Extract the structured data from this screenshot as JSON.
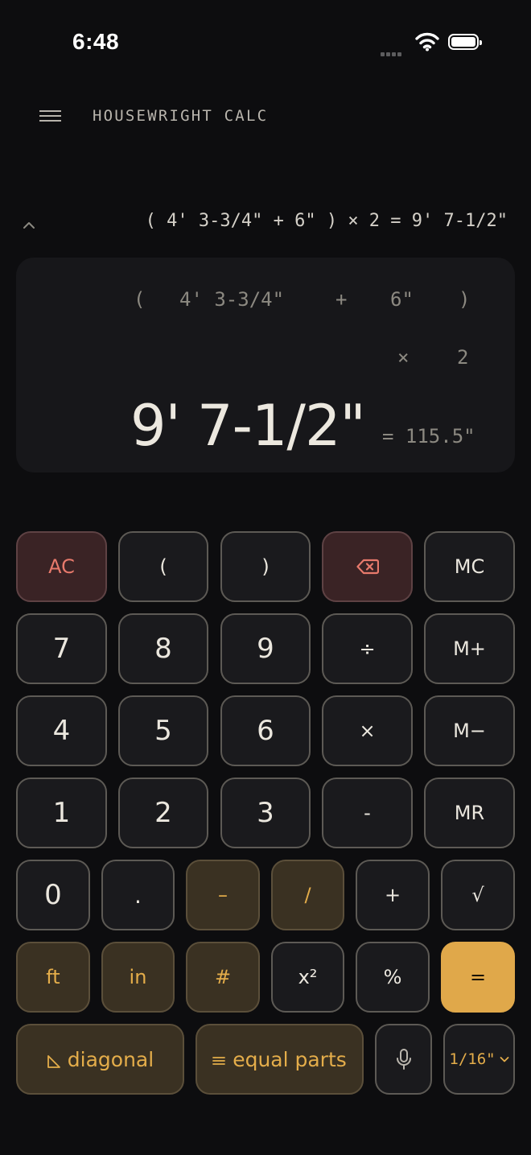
{
  "status": {
    "time": "6:48"
  },
  "header": {
    "menu_icon": "hamburger-menu-icon",
    "title": "HOUSEWRIGHT CALC"
  },
  "history": {
    "toggle_icon": "chevron-up-icon",
    "line": "( 4' 3-3/4\" + 6\" ) × 2 = 9' 7-1/2\""
  },
  "display": {
    "row1": [
      "(",
      "4' 3-3/4\"",
      "+",
      "6\"",
      ")"
    ],
    "row2": [
      "×",
      "2"
    ],
    "result": "9' 7-1/2\"",
    "result_decimal": "= 115.5\""
  },
  "keys": {
    "ac": "AC",
    "open_paren": "(",
    "close_paren": ")",
    "backspace_icon": "backspace-icon",
    "mc": "MC",
    "seven": "7",
    "eight": "8",
    "nine": "9",
    "divide": "÷",
    "m_plus": "M+",
    "four": "4",
    "five": "5",
    "six": "6",
    "multiply": "×",
    "m_minus": "M−",
    "one": "1",
    "two": "2",
    "three": "3",
    "subtract": "-",
    "mr": "MR",
    "zero": "0",
    "decimal": ".",
    "dash": "–",
    "slash": "/",
    "add": "+",
    "sqrt": "√",
    "feet": "ft",
    "inch": "in",
    "hash": "#",
    "square": "x²",
    "percent": "%",
    "equals": "=",
    "diagonal": "diagonal",
    "diagonal_icon": "triangle-ruler-icon",
    "equal_parts": "equal parts",
    "equal_parts_icon": "equal-lines-icon",
    "mic_icon": "microphone-icon",
    "precision": "1/16\"",
    "precision_icon": "chevron-down-icon"
  },
  "colors": {
    "background": "#0d0d0f",
    "display_bg": "#17171a",
    "key_bg": "#1a1a1d",
    "danger_bg": "#3a2325",
    "danger_text": "#e87a6c",
    "gold_bg": "#3a3122",
    "gold_text": "#e4ad4a",
    "equals_bg": "#e0a84a"
  }
}
